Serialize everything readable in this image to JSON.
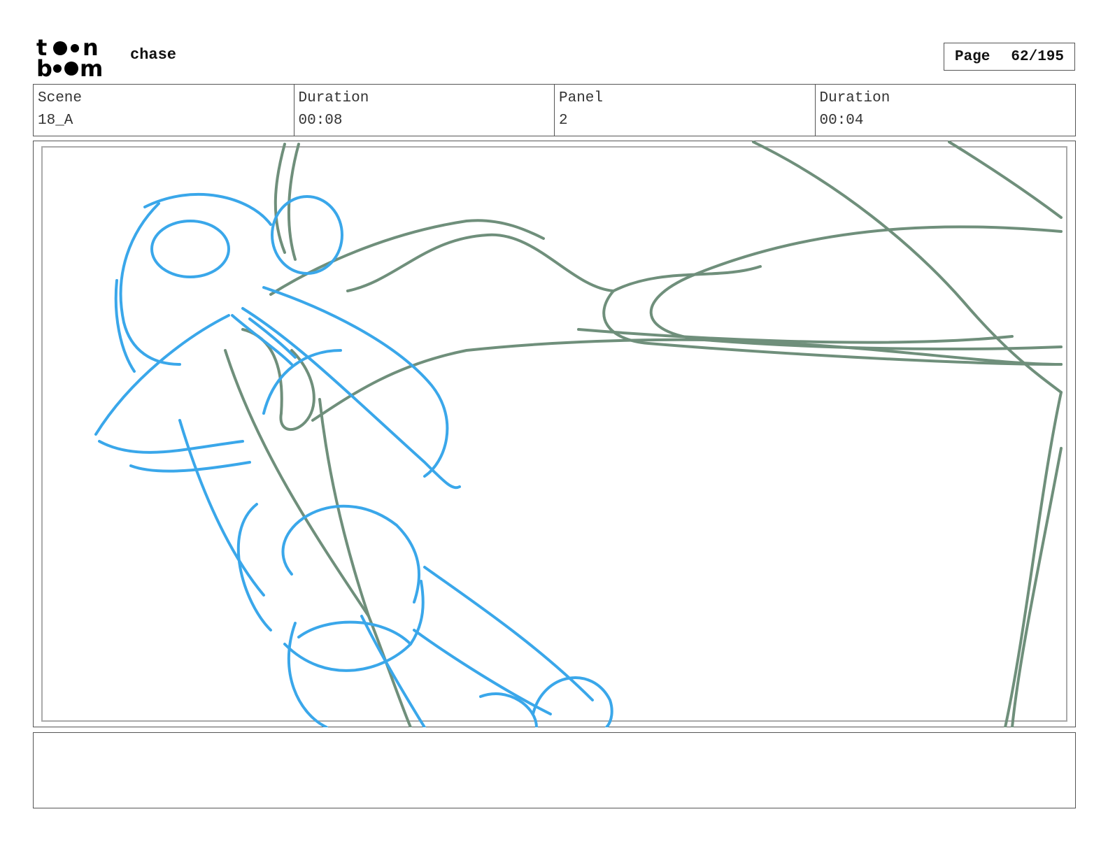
{
  "header": {
    "project_title": "chase",
    "page_label": "Page",
    "page_number": "62/195"
  },
  "info": {
    "scene_label": "Scene",
    "scene_value": "18_A",
    "scene_duration_label": "Duration",
    "scene_duration_value": "00:08",
    "panel_label": "Panel",
    "panel_value": "2",
    "panel_duration_label": "Duration",
    "panel_duration_value": "00:04"
  },
  "colors": {
    "blue_sketch": "#3aa7ea",
    "green_sketch": "#6f8f7b"
  },
  "caption": {
    "text": ""
  }
}
